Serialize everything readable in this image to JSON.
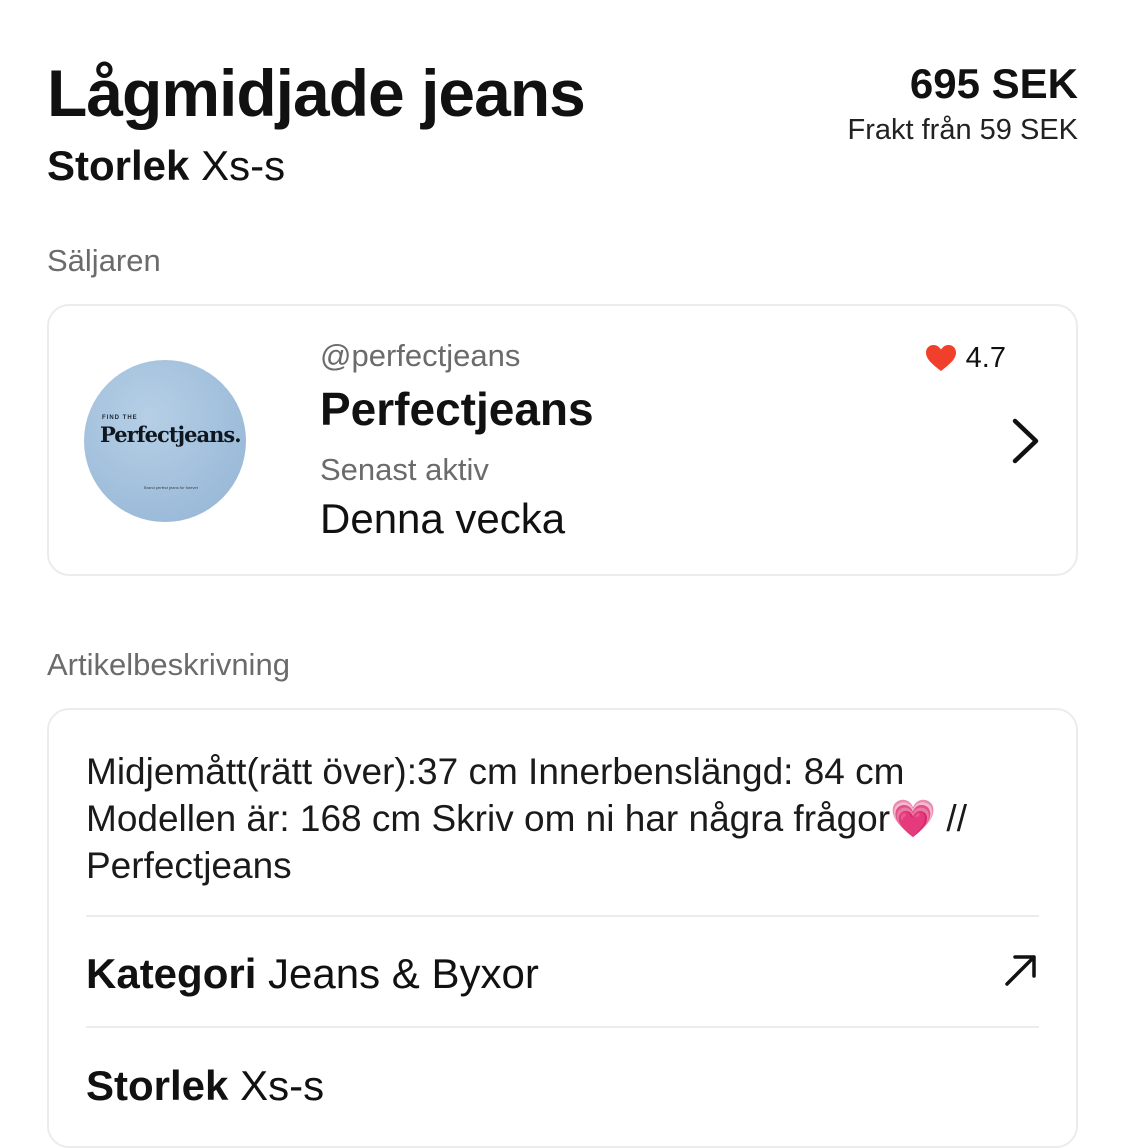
{
  "product": {
    "title": "Lågmidjade jeans",
    "size_label": "Storlek",
    "size_value": "Xs-s",
    "price": "695 SEK",
    "shipping_label": "Frakt från",
    "shipping_value": "59 SEK"
  },
  "seller_section": {
    "label": "Säljaren",
    "handle": "@perfectjeans",
    "name": "Perfectjeans",
    "rating": "4.7",
    "last_active_label": "Senast aktiv",
    "last_active_value": "Denna vecka",
    "avatar": {
      "top_text": "FIND THE",
      "brand": "Perfectjeans.",
      "tagline": "Brand perfect jeans\nfor forever"
    },
    "icons": {
      "rating": "heart-icon",
      "open": "chevron-right-icon"
    },
    "colors": {
      "heart": "#f0402b"
    }
  },
  "description_section": {
    "label": "Artikelbeskrivning",
    "text_line1": "Midjemått(rätt över):37 cm Innerbenslängd: 84 cm",
    "text_line2": "Modellen är: 168 cm  Skriv om ni har några frågor💗 //",
    "text_line3": "Perfectjeans",
    "category_label": "Kategori",
    "category_value": "Jeans & Byxor",
    "size_label": "Storlek",
    "size_value": "Xs-s",
    "icons": {
      "category_link": "arrow-up-right-icon"
    }
  }
}
